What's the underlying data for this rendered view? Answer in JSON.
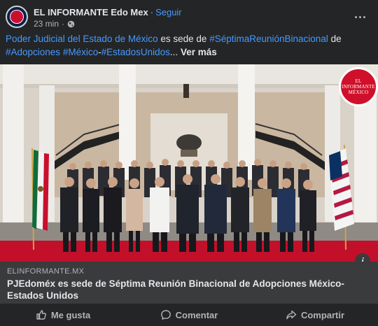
{
  "header": {
    "page_name": "EL INFORMANTE Edo Mex",
    "separator": "·",
    "follow_label": "Seguir",
    "time": "23 min",
    "time_separator": "·",
    "privacy_icon": "globe-icon",
    "more_icon": "more-options-icon"
  },
  "caption": {
    "mention": "Poder Judicial del Estado de México",
    "text1": " es sede de ",
    "tag1": "#SéptimaReuniónBinacional",
    "text2": " de ",
    "tag2": "#Adopciones",
    "text3": " ",
    "tag3": "#México",
    "text4": "-",
    "tag4": "#EstadosUnidos",
    "ellipsis": "... ",
    "see_more": "Ver más"
  },
  "photo": {
    "watermark_line1": "EL",
    "watermark_line2": "INFORMANTE",
    "watermark_line3": "MÉXICO",
    "info_label": "i"
  },
  "link_preview": {
    "domain": "ELINFORMANTE.MX",
    "title": "PJEdoméx es sede de Séptima Reunión Binacional de Adopciones México-Estados Unidos"
  },
  "actions": {
    "like_label": "Me gusta",
    "comment_label": "Comentar",
    "share_label": "Compartir"
  },
  "colors": {
    "background": "#242526",
    "link": "#4599ff",
    "preview_bg": "#3a3b3c",
    "carpet_red": "#c2102a"
  }
}
